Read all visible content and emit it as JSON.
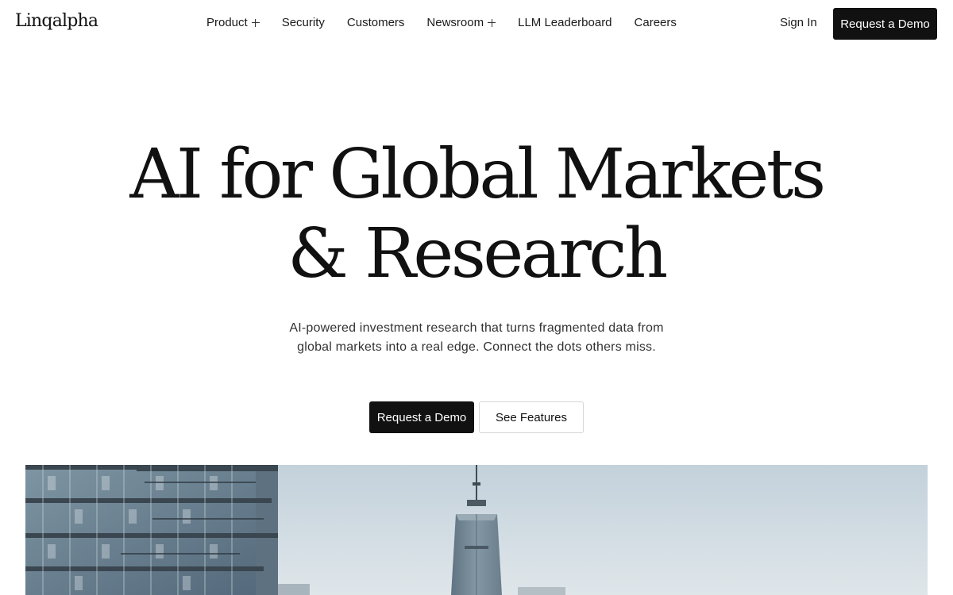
{
  "header": {
    "logo": "Linqalpha",
    "nav": [
      {
        "label": "Product",
        "has_menu": true
      },
      {
        "label": "Security",
        "has_menu": false
      },
      {
        "label": "Customers",
        "has_menu": false
      },
      {
        "label": "Newsroom",
        "has_menu": true
      },
      {
        "label": "LLM Leaderboard",
        "has_menu": false
      },
      {
        "label": "Careers",
        "has_menu": false
      }
    ],
    "sign_in": "Sign In",
    "request_demo": "Request a Demo"
  },
  "hero": {
    "title_line1": "AI for Global Markets",
    "title_line2": "& Research",
    "subtitle": "AI-powered investment research that turns fragmented data from global markets into a real edge. Connect the dots others miss.",
    "primary_cta": "Request a Demo",
    "secondary_cta": "See Features"
  },
  "colors": {
    "text": "#111111",
    "button_dark": "#111111",
    "sky": "#c9d6de"
  },
  "icons": {
    "menu_expand": "plus-icon"
  }
}
